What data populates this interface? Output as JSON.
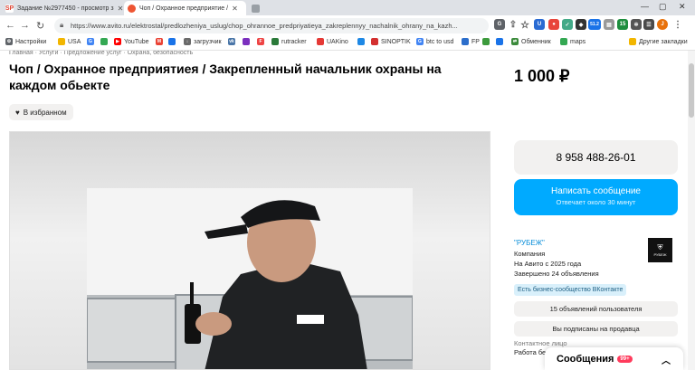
{
  "browser": {
    "tabs": [
      {
        "title": "Задание №2977450 - просмотр з",
        "icon": "sp-favicon"
      },
      {
        "title": "Чоп / Охранное предприятие /",
        "icon": "avito-favicon"
      },
      {
        "title": "",
        "icon": "new-tab-favicon"
      }
    ],
    "url": "https://www.avito.ru/elektrostal/predlozheniya_uslug/chop_ohrannoe_predpriyatieya_zakreplennyy_nachalnik_ohrany_na_kazh...",
    "extensions": {
      "badge_ltc": "LTC",
      "badge_val": "51.2",
      "badge_15": "15"
    },
    "bookmarks": [
      {
        "label": "Настройки",
        "icon": "gear-icon"
      },
      {
        "label": "USA",
        "icon": "folder-icon"
      },
      {
        "label": "",
        "icon": "google-icon"
      },
      {
        "label": "",
        "icon": "docs-icon"
      },
      {
        "label": "YouTube",
        "icon": "youtube-icon"
      },
      {
        "label": "",
        "icon": "gmail-icon"
      },
      {
        "label": "",
        "icon": "drive-icon"
      },
      {
        "label": "загрузчик",
        "icon": "download-icon"
      },
      {
        "label": "",
        "icon": "vk-icon"
      },
      {
        "label": "",
        "icon": "market-icon"
      },
      {
        "label": "",
        "icon": "pdf-icon"
      },
      {
        "label": "rutracker",
        "icon": "rutracker-icon"
      },
      {
        "label": "UAKino",
        "icon": "uakino-icon"
      },
      {
        "label": "",
        "icon": "chart-icon"
      },
      {
        "label": "SINOPTIK",
        "icon": "weather-icon"
      },
      {
        "label": "btc to usd",
        "icon": "google-icon"
      },
      {
        "label": "FP",
        "icon": "fp-icon"
      },
      {
        "label": "",
        "icon": "image-icon"
      },
      {
        "label": "",
        "icon": "translate-icon"
      },
      {
        "label": "Обменник",
        "icon": "exchange-icon"
      },
      {
        "label": "maps",
        "icon": "maps-icon"
      },
      {
        "label": "Другие закладки",
        "icon": "folder-icon"
      }
    ]
  },
  "page": {
    "breadcrumbs": "Главная · Услуги · Предложение услуг · Охрана, безопасность",
    "title": "Чоп / Охранное предприятиея / Закрепленный начальник охраны на каждом обьекте",
    "price": "1 000 ₽",
    "favorite_label": "В избранном",
    "phone": "8 958 488-26-01",
    "message_button": "Написать сообщение",
    "message_sub": "Отвечает около 30 минут",
    "seller": {
      "name": "\"РУБЕЖ\"",
      "type": "Компания",
      "since": "На Авито с 2025 года",
      "completed": "Завершено 24 объявления",
      "badge": "Есть бизнес-сообщество ВКонтакте",
      "logo_text": "РУБЕЖ"
    },
    "listings_button": "15 объявлений пользователя",
    "subscribed_button": "Вы подписаны на продавца",
    "contact_label": "Контактное лицо",
    "contact_value": "Работа бе",
    "messenger_label": "Сообщения",
    "messenger_count": "99+"
  },
  "colors": {
    "accent": "#00aaff",
    "link": "#0a8ed9",
    "badge_bg": "#d9f0fb",
    "button_gray": "#f2f1f0"
  }
}
